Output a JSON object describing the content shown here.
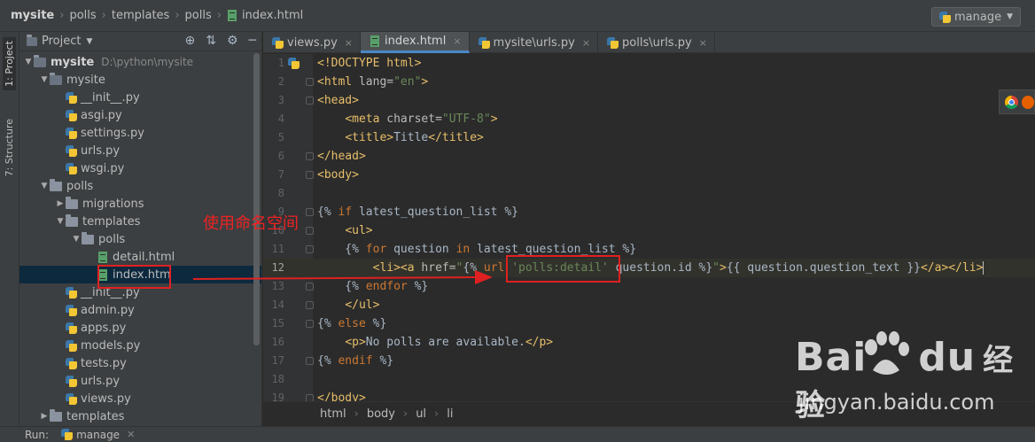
{
  "breadcrumb": {
    "items": [
      "mysite",
      "polls",
      "templates",
      "polls",
      "index.html"
    ]
  },
  "run_config": {
    "label": "manage"
  },
  "tool_strip": {
    "project_tab": "1: Project",
    "structure_tab": "7: Structure"
  },
  "project_panel": {
    "title": "Project",
    "tree": [
      {
        "label": "mysite",
        "note": "D:\\python\\mysite",
        "type": "folder",
        "depth": 0,
        "expanded": true
      },
      {
        "label": "mysite",
        "type": "folder",
        "depth": 1,
        "expanded": true
      },
      {
        "label": "__init__.py",
        "type": "py",
        "depth": 2
      },
      {
        "label": "asgi.py",
        "type": "py",
        "depth": 2
      },
      {
        "label": "settings.py",
        "type": "py",
        "depth": 2
      },
      {
        "label": "urls.py",
        "type": "py",
        "depth": 2
      },
      {
        "label": "wsgi.py",
        "type": "py",
        "depth": 2
      },
      {
        "label": "polls",
        "type": "folder",
        "depth": 1,
        "expanded": true
      },
      {
        "label": "migrations",
        "type": "folder",
        "depth": 2,
        "expanded": false
      },
      {
        "label": "templates",
        "type": "folder",
        "depth": 2,
        "expanded": true
      },
      {
        "label": "polls",
        "type": "folder",
        "depth": 3,
        "expanded": true
      },
      {
        "label": "detail.html",
        "type": "html",
        "depth": 4
      },
      {
        "label": "index.htm",
        "type": "html",
        "depth": 4,
        "selected": true
      },
      {
        "label": "__init__.py",
        "type": "py",
        "depth": 2
      },
      {
        "label": "admin.py",
        "type": "py",
        "depth": 2
      },
      {
        "label": "apps.py",
        "type": "py",
        "depth": 2
      },
      {
        "label": "models.py",
        "type": "py",
        "depth": 2
      },
      {
        "label": "tests.py",
        "type": "py",
        "depth": 2
      },
      {
        "label": "urls.py",
        "type": "py",
        "depth": 2
      },
      {
        "label": "views.py",
        "type": "py",
        "depth": 2
      },
      {
        "label": "templates",
        "type": "folder",
        "depth": 1,
        "expanded": false
      }
    ]
  },
  "editor_tabs": [
    {
      "label": "views.py",
      "icon": "python-file-icon",
      "active": false
    },
    {
      "label": "index.html",
      "icon": "html-file-icon",
      "active": true
    },
    {
      "label": "mysite\\urls.py",
      "icon": "python-file-icon",
      "active": false
    },
    {
      "label": "polls\\urls.py",
      "icon": "python-file-icon",
      "active": false
    }
  ],
  "code_lines": [
    {
      "n": "1",
      "fold": false,
      "segs": [
        [
          "tg",
          "<!DOCTYPE html>"
        ]
      ]
    },
    {
      "n": "2",
      "fold": true,
      "segs": [
        [
          "tg",
          "<html "
        ],
        [
          "at",
          "lang="
        ],
        [
          "av",
          "\"en\""
        ],
        [
          "tg",
          ">"
        ]
      ]
    },
    {
      "n": "3",
      "fold": true,
      "segs": [
        [
          "tg",
          "<head>"
        ]
      ]
    },
    {
      "n": "4",
      "fold": false,
      "segs": [
        [
          "tx",
          "    "
        ],
        [
          "tg",
          "<meta "
        ],
        [
          "at",
          "charset="
        ],
        [
          "av",
          "\"UTF-8\""
        ],
        [
          "tg",
          ">"
        ]
      ]
    },
    {
      "n": "5",
      "fold": false,
      "segs": [
        [
          "tx",
          "    "
        ],
        [
          "tg",
          "<title>"
        ],
        [
          "tx",
          "Title"
        ],
        [
          "tg",
          "</title>"
        ]
      ]
    },
    {
      "n": "6",
      "fold": true,
      "segs": [
        [
          "tg",
          "</head>"
        ]
      ]
    },
    {
      "n": "7",
      "fold": true,
      "segs": [
        [
          "tg",
          "<body>"
        ]
      ]
    },
    {
      "n": "8",
      "fold": false,
      "segs": []
    },
    {
      "n": "9",
      "fold": true,
      "segs": [
        [
          "tx",
          "{% "
        ],
        [
          "dj",
          "if"
        ],
        [
          "tx",
          " latest_question_list %}"
        ]
      ]
    },
    {
      "n": "10",
      "fold": true,
      "segs": [
        [
          "tx",
          "    "
        ],
        [
          "tg",
          "<ul>"
        ]
      ]
    },
    {
      "n": "11",
      "fold": true,
      "segs": [
        [
          "tx",
          "    {% "
        ],
        [
          "dj",
          "for"
        ],
        [
          "tx",
          " question "
        ],
        [
          "dj",
          "in"
        ],
        [
          "tx",
          " latest_question_list %}"
        ]
      ]
    },
    {
      "n": "12",
      "fold": false,
      "current": true,
      "segs": [
        [
          "tx",
          "        "
        ],
        [
          "tg",
          "<li><a "
        ],
        [
          "at",
          "href="
        ],
        [
          "av",
          "\""
        ],
        [
          "tx",
          "{% "
        ],
        [
          "dj",
          "url"
        ],
        [
          "tx",
          " "
        ],
        [
          "av",
          "'polls:detail'"
        ],
        [
          "tx",
          " question.id %}"
        ],
        [
          "av",
          "\""
        ],
        [
          "tg",
          ">"
        ],
        [
          "tx",
          "{{ question.question_text }}"
        ],
        [
          "tg",
          "</a></li>"
        ]
      ]
    },
    {
      "n": "13",
      "fold": true,
      "segs": [
        [
          "tx",
          "    {% "
        ],
        [
          "dj",
          "endfor"
        ],
        [
          "tx",
          " %}"
        ]
      ]
    },
    {
      "n": "14",
      "fold": true,
      "segs": [
        [
          "tx",
          "    "
        ],
        [
          "tg",
          "</ul>"
        ]
      ]
    },
    {
      "n": "15",
      "fold": true,
      "segs": [
        [
          "tx",
          "{% "
        ],
        [
          "dj",
          "else"
        ],
        [
          "tx",
          " %}"
        ]
      ]
    },
    {
      "n": "16",
      "fold": false,
      "segs": [
        [
          "tx",
          "    "
        ],
        [
          "tg",
          "<p>"
        ],
        [
          "tx",
          "No polls are available."
        ],
        [
          "tg",
          "</p>"
        ]
      ]
    },
    {
      "n": "17",
      "fold": true,
      "segs": [
        [
          "tx",
          "{% "
        ],
        [
          "dj",
          "endif"
        ],
        [
          "tx",
          " %}"
        ]
      ]
    },
    {
      "n": "18",
      "fold": false,
      "segs": []
    },
    {
      "n": "19",
      "fold": true,
      "segs": [
        [
          "tg",
          "</body>"
        ]
      ]
    }
  ],
  "editor_breadcrumb": [
    "html",
    "body",
    "ul",
    "li"
  ],
  "run_bar": {
    "label": "Run:",
    "config": "manage"
  },
  "annotation": {
    "text": "使用命名空间"
  },
  "watermark": {
    "logo_left": "Bai",
    "logo_du": "du",
    "logo_cn": "经验",
    "url": "jingyan.baidu.com"
  }
}
